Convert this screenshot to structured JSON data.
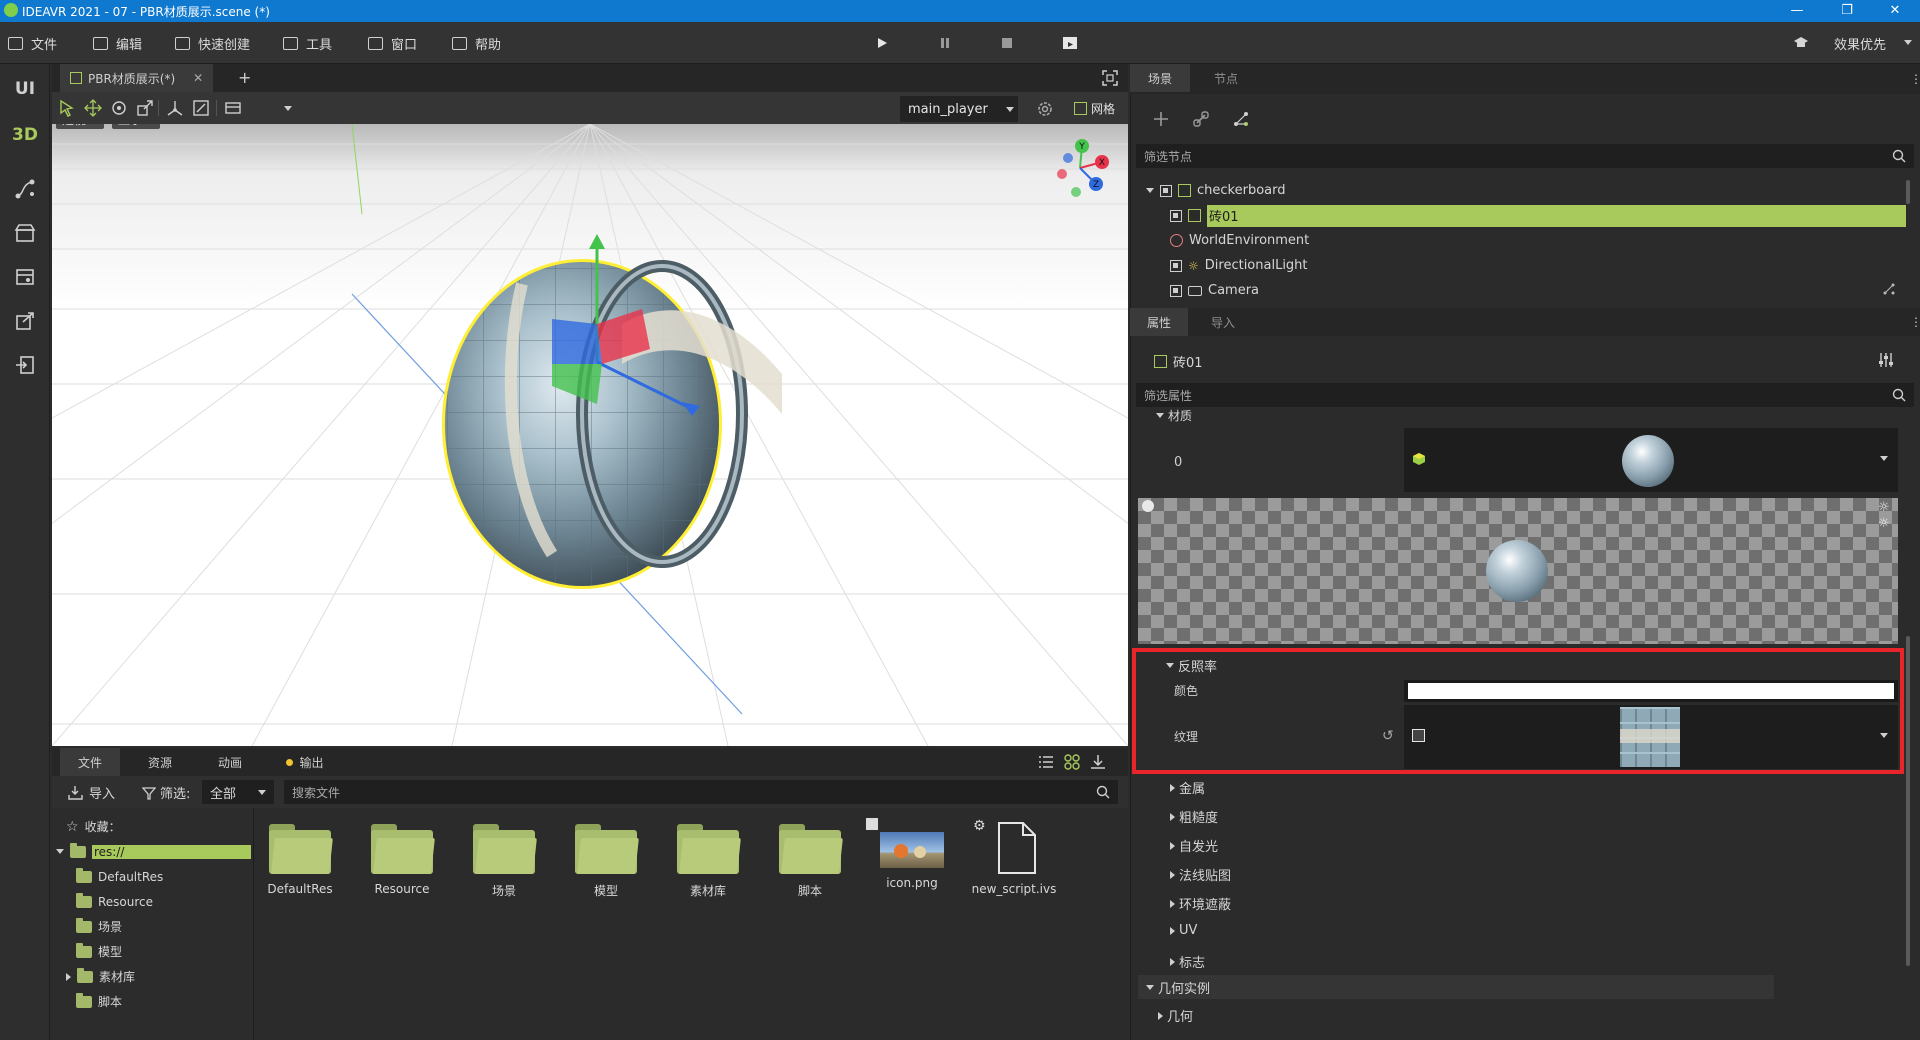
{
  "window": {
    "title": "IDEAVR 2021 - 07 - PBR材质展示.scene (*)",
    "controls": [
      "minimize-icon",
      "restore-icon",
      "close-icon"
    ]
  },
  "menu": {
    "items": [
      {
        "label": "文件",
        "icon": "file-icon"
      },
      {
        "label": "编辑",
        "icon": "crop-icon"
      },
      {
        "label": "快速创建",
        "icon": "edit-icon"
      },
      {
        "label": "工具",
        "icon": "tools-icon"
      },
      {
        "label": "窗口",
        "icon": "window-icon"
      },
      {
        "label": "帮助",
        "icon": "help-icon"
      }
    ],
    "playback": [
      "play-icon",
      "pause-icon",
      "stop-icon",
      "clapper-icon"
    ],
    "right_label": "效果优先"
  },
  "left_toolbar": {
    "ui_label": "UI",
    "3d_label": "3D",
    "icons": [
      "path-icon",
      "store-icon",
      "media-icon",
      "export-icon",
      "import-icon"
    ]
  },
  "viewport": {
    "tab_label": "PBR材质展示(*)",
    "add_tab": "+",
    "camera_select": "main_player",
    "grid_label": "网格",
    "perspective_label": "透视",
    "display_label": "显示",
    "gizmo_axes": [
      "X",
      "Y",
      "Z"
    ]
  },
  "files": {
    "tabs": [
      "文件",
      "资源",
      "动画",
      "输出"
    ],
    "import_label": "导入",
    "filter_label": "筛选:",
    "filter_value": "全部",
    "search_placeholder": "搜索文件",
    "tree": {
      "favorites": "收藏：",
      "root": "res://",
      "children": [
        "DefaultRes",
        "Resource",
        "场景",
        "模型",
        "素材库",
        "脚本"
      ]
    },
    "items": [
      {
        "name": "DefaultRes",
        "type": "folder"
      },
      {
        "name": "Resource",
        "type": "folder"
      },
      {
        "name": "场景",
        "type": "folder"
      },
      {
        "name": "模型",
        "type": "folder"
      },
      {
        "name": "素材库",
        "type": "folder"
      },
      {
        "name": "脚本",
        "type": "folder"
      },
      {
        "name": "icon.png",
        "type": "image"
      },
      {
        "name": "new_script.ivs",
        "type": "script"
      }
    ]
  },
  "scene": {
    "tabs": [
      "场景",
      "节点"
    ],
    "filter_placeholder": "筛选节点",
    "nodes": [
      {
        "label": "checkerboard",
        "level": 0,
        "selected": false
      },
      {
        "label": "砖01",
        "level": 1,
        "selected": true
      },
      {
        "label": "WorldEnvironment",
        "level": 1,
        "selected": false
      },
      {
        "label": "DirectionalLight",
        "level": 1,
        "selected": false
      },
      {
        "label": "Camera",
        "level": 1,
        "selected": false
      }
    ]
  },
  "properties": {
    "tabs": [
      "属性",
      "导入"
    ],
    "object_name": "砖01",
    "filter_placeholder": "筛选属性",
    "material_section": "材质",
    "material_index": "0",
    "albedo_section": "反照率",
    "color_label": "颜色",
    "texture_label": "纹理",
    "color_value": "#ffffff",
    "collapsed_sections": [
      "金属",
      "粗糙度",
      "自发光",
      "法线贴图",
      "环境遮蔽",
      "UV",
      "标志"
    ],
    "geometry_section": "几何实例",
    "geometry_sub": "几何"
  },
  "colors": {
    "accent": "#a8c95b",
    "titlebar": "#0f79d0",
    "highlight_box": "#e8252b"
  }
}
